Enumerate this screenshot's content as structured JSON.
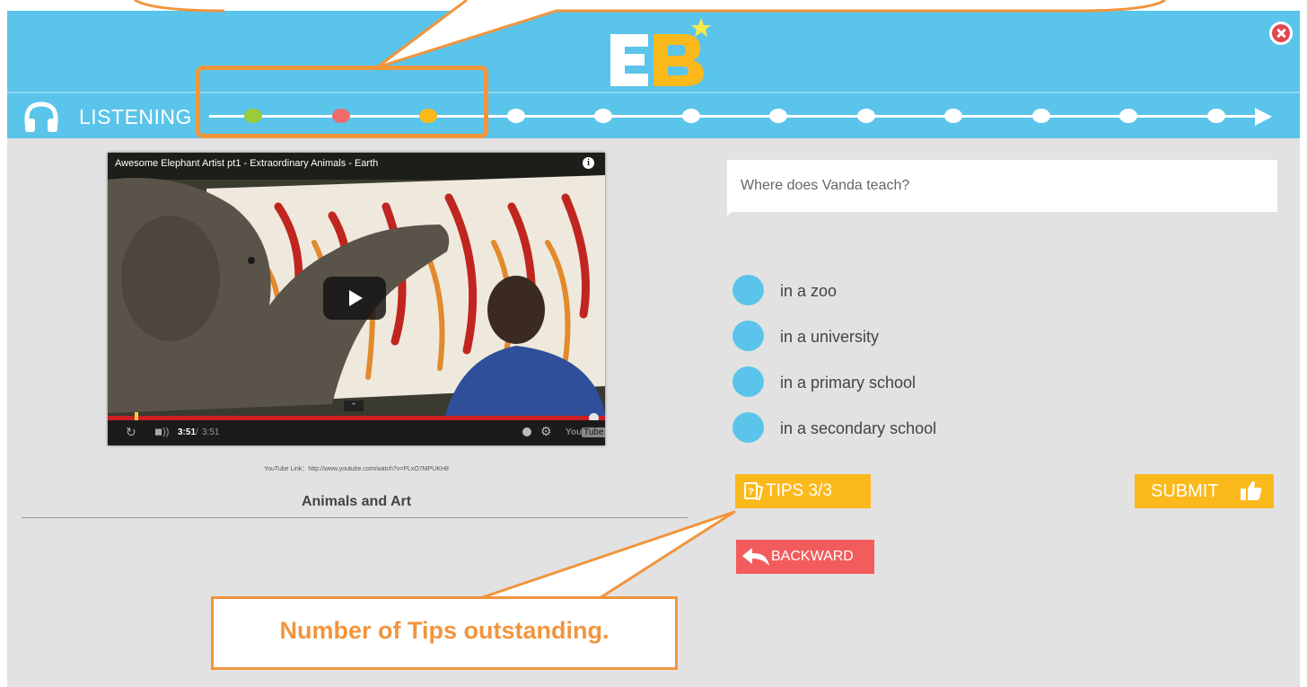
{
  "header": {
    "logo_letters": "EB",
    "close_icon": "close-icon"
  },
  "progress": {
    "section_label": "LISTENING",
    "step_colors": [
      "#9acd3a",
      "#f06a6a",
      "#fbb91b",
      "#ffffff",
      "#ffffff",
      "#ffffff",
      "#ffffff",
      "#ffffff",
      "#ffffff",
      "#ffffff",
      "#ffffff",
      "#ffffff"
    ]
  },
  "video": {
    "title": "Awesome Elephant Artist pt1 - Extraordinary Animals - Earth",
    "time_current": "3:51",
    "time_separator": "/",
    "time_total": "3:51",
    "youtube_logo_prefix": "You",
    "youtube_logo_suffix": "Tube",
    "progress_fraction": 1.0,
    "link": "YouTube Link：http://www.youtube.com/watch?v=PLxO7MPUKH8",
    "lesson_title": "Animals and Art"
  },
  "question": {
    "text": "Where does Vanda teach?",
    "options": [
      "in a zoo",
      "in a university",
      "in a primary school",
      "in a secondary school"
    ]
  },
  "buttons": {
    "tips_label": "TIPS 3/3",
    "submit_label": "SUBMIT",
    "backward_label": "BACKWARD"
  },
  "tutorial": {
    "tips_callout": "Number of Tips outstanding."
  },
  "colors": {
    "brand_blue": "#5bc4ea",
    "accent_orange": "#fbb91b",
    "danger_red": "#f25c5c",
    "callout_orange": "#f1953d"
  }
}
